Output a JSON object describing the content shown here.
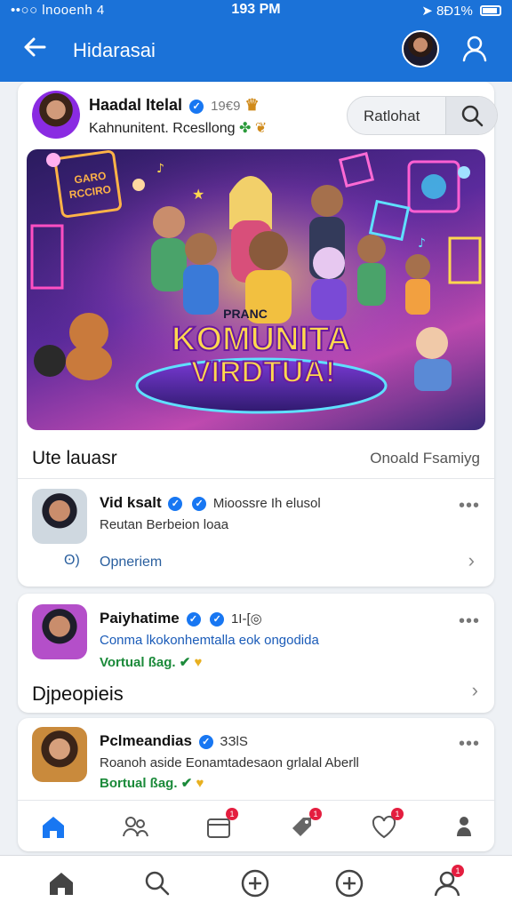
{
  "status_bar": {
    "carrier": "••○○ lnooenh 4",
    "time": "193 PM",
    "battery": "8Ð1%"
  },
  "header": {
    "back_icon": "arrow-left-icon",
    "title": "Hidarasai",
    "profile_icon": "user-icon"
  },
  "post": {
    "author": "Haadal Itelal",
    "author_meta": "19€9",
    "subtitle": "Kahnunitent. Rcesllong",
    "search_label": "Ratlohat",
    "hero_title_line1": "KOMUNITA",
    "hero_title_line2": "VIRDTUA!",
    "hero_banner": "PRANC",
    "hero_sign_line1": "GARO",
    "hero_sign_line2": "RCCIRO"
  },
  "section": {
    "title": "Ute lauasr",
    "link": "Onoald Fsamiyg"
  },
  "feed": [
    {
      "name": "Vid ksalt",
      "meta": "Mioossre Ih elusol",
      "line2": "Reutan Berbeion loaa",
      "action": "Opneriem"
    },
    {
      "name": "Paiyhatime",
      "meta": "1I-[◎",
      "line2": "Conma lkokonhemtalla eok ongodida",
      "line3": "Vortual ßag."
    },
    {
      "name": "Pclmeandias",
      "meta": "ЗЗlS",
      "line2": "Roanoh aside Eonamtadesaon grlalal Aberll",
      "line3": "Bortual ßag."
    }
  ],
  "sub_heading": "Djpeopieis",
  "inner_tabs": [
    {
      "icon": "home-icon",
      "badge": ""
    },
    {
      "icon": "people-icon",
      "badge": ""
    },
    {
      "icon": "calendar-icon",
      "badge": "1"
    },
    {
      "icon": "tag-icon",
      "badge": "1"
    },
    {
      "icon": "heart-icon",
      "badge": "1"
    },
    {
      "icon": "person-icon",
      "badge": ""
    }
  ],
  "bottom_nav": [
    {
      "icon": "home-icon",
      "badge": ""
    },
    {
      "icon": "search-icon",
      "badge": ""
    },
    {
      "icon": "plus-circle-icon",
      "badge": ""
    },
    {
      "icon": "plus-circle-icon",
      "badge": ""
    },
    {
      "icon": "profile-icon",
      "badge": "1"
    }
  ],
  "colors": {
    "brand": "#1b72d8",
    "accent_blue": "#1877f2",
    "green": "#1b8a3a",
    "badge": "#e41e3f"
  }
}
